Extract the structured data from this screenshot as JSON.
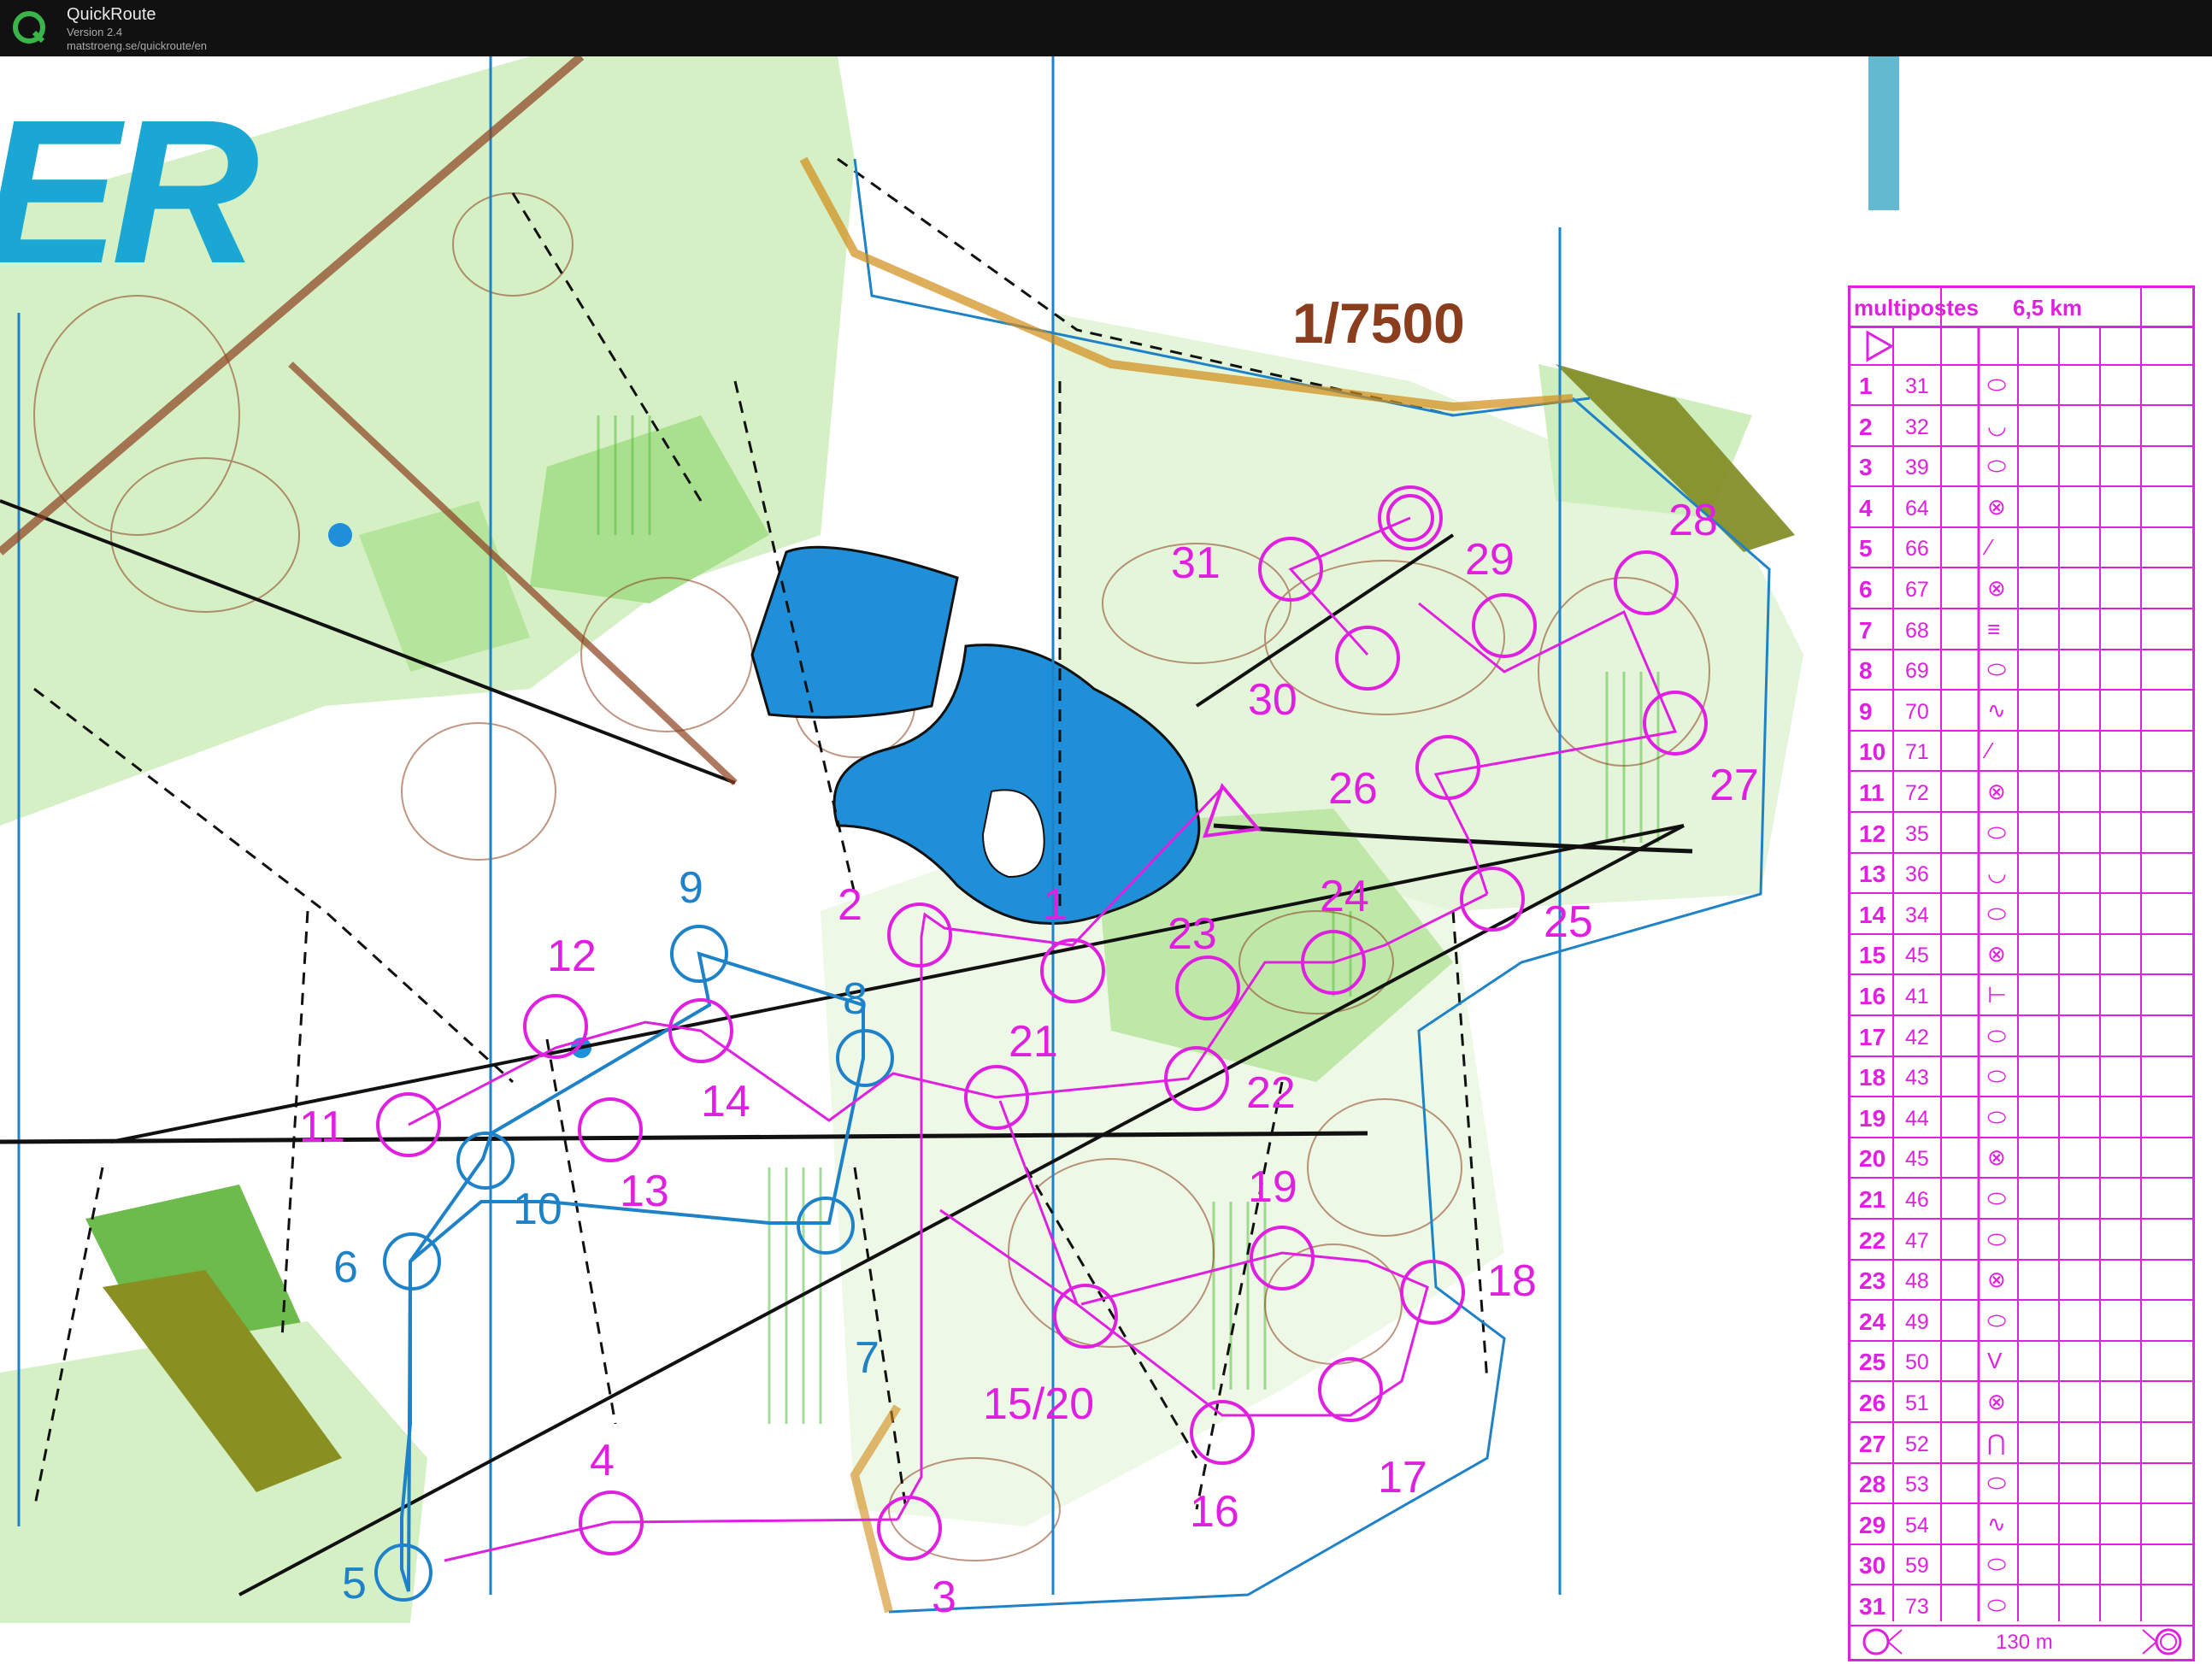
{
  "window": {
    "title": "QuickRoute",
    "version": "Version 2.4",
    "url": "matstroeng.se/quickroute/en"
  },
  "map": {
    "scale": "1/7500",
    "logo_text": "ER",
    "colors": {
      "course": "#e020e0",
      "route": "#1e82c8",
      "forest": "#b8e6a0",
      "water": "#1e8fd8",
      "contour": "#8b3e1e"
    },
    "controls_course": [
      {
        "label": "1"
      },
      {
        "label": "2"
      },
      {
        "label": "3"
      },
      {
        "label": "11"
      },
      {
        "label": "12"
      },
      {
        "label": "13"
      },
      {
        "label": "14"
      },
      {
        "label": "15/20"
      },
      {
        "label": "16"
      },
      {
        "label": "17"
      },
      {
        "label": "18"
      },
      {
        "label": "19"
      },
      {
        "label": "21"
      },
      {
        "label": "22"
      },
      {
        "label": "23"
      },
      {
        "label": "24"
      },
      {
        "label": "25"
      },
      {
        "label": "26"
      },
      {
        "label": "27"
      },
      {
        "label": "28"
      },
      {
        "label": "29"
      },
      {
        "label": "30"
      },
      {
        "label": "31"
      }
    ],
    "controls_route": [
      {
        "label": "4"
      },
      {
        "label": "5"
      },
      {
        "label": "6"
      },
      {
        "label": "7"
      },
      {
        "label": "8"
      },
      {
        "label": "9"
      },
      {
        "label": "10"
      }
    ]
  },
  "legend": {
    "course": "multipostes",
    "length": "6,5 km",
    "finish_distance": "130 m",
    "rows": [
      {
        "num": "1",
        "code": "31"
      },
      {
        "num": "2",
        "code": "32"
      },
      {
        "num": "3",
        "code": "39"
      },
      {
        "num": "4",
        "code": "64"
      },
      {
        "num": "5",
        "code": "66"
      },
      {
        "num": "6",
        "code": "67"
      },
      {
        "num": "7",
        "code": "68"
      },
      {
        "num": "8",
        "code": "69"
      },
      {
        "num": "9",
        "code": "70"
      },
      {
        "num": "10",
        "code": "71"
      },
      {
        "num": "11",
        "code": "72"
      },
      {
        "num": "12",
        "code": "35"
      },
      {
        "num": "13",
        "code": "36"
      },
      {
        "num": "14",
        "code": "34"
      },
      {
        "num": "15",
        "code": "45"
      },
      {
        "num": "16",
        "code": "41"
      },
      {
        "num": "17",
        "code": "42"
      },
      {
        "num": "18",
        "code": "43"
      },
      {
        "num": "19",
        "code": "44"
      },
      {
        "num": "20",
        "code": "45"
      },
      {
        "num": "21",
        "code": "46"
      },
      {
        "num": "22",
        "code": "47"
      },
      {
        "num": "23",
        "code": "48"
      },
      {
        "num": "24",
        "code": "49"
      },
      {
        "num": "25",
        "code": "50"
      },
      {
        "num": "26",
        "code": "51"
      },
      {
        "num": "27",
        "code": "52"
      },
      {
        "num": "28",
        "code": "53"
      },
      {
        "num": "29",
        "code": "54"
      },
      {
        "num": "30",
        "code": "59"
      },
      {
        "num": "31",
        "code": "73"
      }
    ]
  }
}
